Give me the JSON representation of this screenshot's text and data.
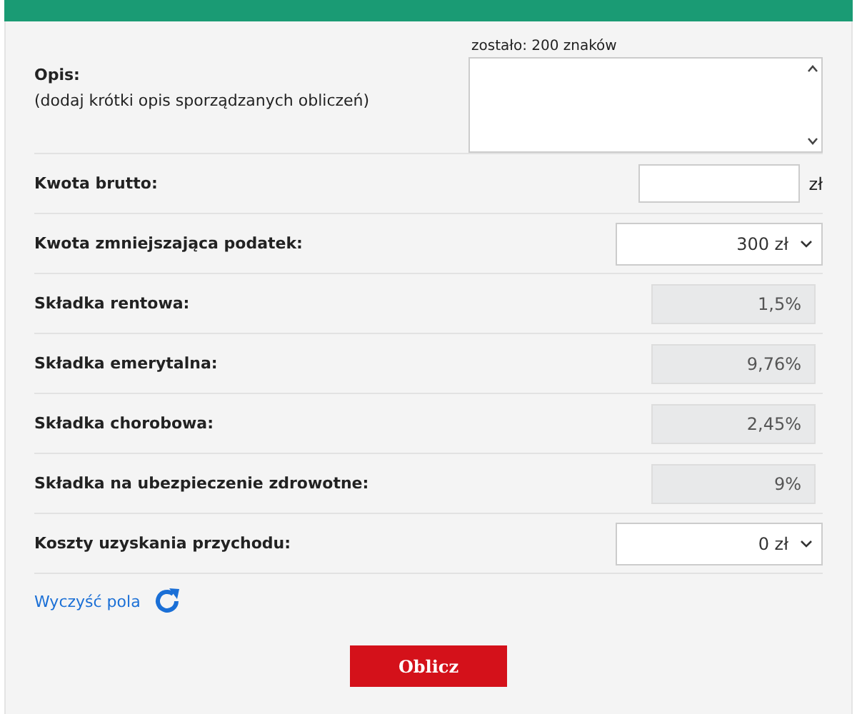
{
  "description": {
    "label": "Opis:",
    "hint": "(dodaj krótki opis sporządzanych obliczeń)",
    "counter": "zostało: 200 znaków"
  },
  "rows": [
    {
      "kind": "input",
      "label": "Kwota brutto:",
      "unit": "zł"
    },
    {
      "kind": "select",
      "label": "Kwota zmniejszająca podatek:",
      "value": "300 zł"
    },
    {
      "kind": "readonly",
      "label": "Składka rentowa:",
      "value": "1,5%"
    },
    {
      "kind": "readonly",
      "label": "Składka emerytalna:",
      "value": "9,76%"
    },
    {
      "kind": "readonly",
      "label": "Składka chorobowa:",
      "value": "2,45%"
    },
    {
      "kind": "readonly",
      "label": "Składka na ubezpieczenie zdrowotne:",
      "value": "9%"
    },
    {
      "kind": "select",
      "label": "Koszty uzyskania przychodu:",
      "value": "0 zł"
    }
  ],
  "clear_link": "Wyczyść pola",
  "submit": "Oblicz"
}
